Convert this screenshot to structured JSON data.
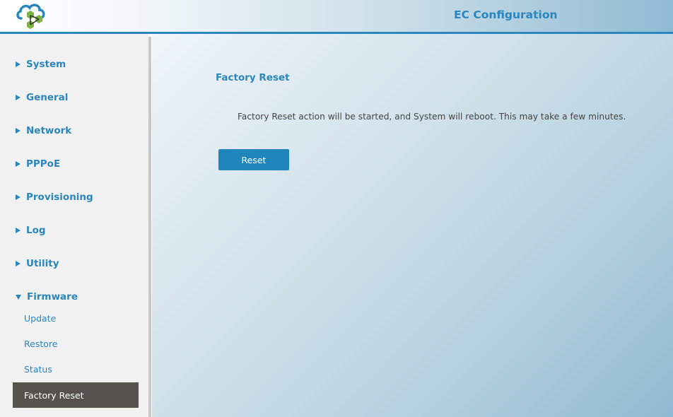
{
  "header": {
    "title": "EC Configuration",
    "logo_icon": "cloud-hexagon-logo-icon",
    "accent_color": "#2a86bd"
  },
  "sidebar": {
    "items": [
      {
        "label": "System",
        "icon": "triangle-right-icon"
      },
      {
        "label": "General",
        "icon": "triangle-right-icon"
      },
      {
        "label": "Network",
        "icon": "triangle-right-icon"
      },
      {
        "label": "PPPoE",
        "icon": "triangle-right-icon"
      },
      {
        "label": "Provisioning",
        "icon": "triangle-right-icon"
      },
      {
        "label": "Log",
        "icon": "triangle-right-icon"
      },
      {
        "label": "Utility",
        "icon": "triangle-right-icon"
      },
      {
        "label": "Firmware",
        "icon": "triangle-down-icon",
        "expanded": true
      }
    ],
    "firmware_subitems": [
      {
        "label": "Update"
      },
      {
        "label": "Restore"
      },
      {
        "label": "Status"
      },
      {
        "label": "Factory Reset",
        "active": true
      }
    ],
    "active_item_color": "#55524e"
  },
  "main": {
    "section_title": "Factory Reset",
    "description": "Factory Reset action will be started, and System will reboot. This may take a few minutes.",
    "reset_button_label": "Reset",
    "button_color": "#1f86bd"
  }
}
